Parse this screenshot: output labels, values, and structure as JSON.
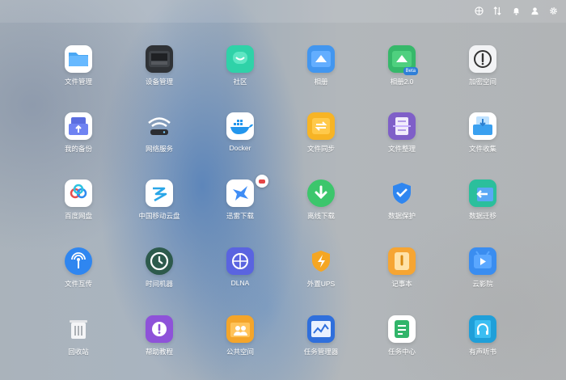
{
  "tray": {
    "icons": [
      "grid-icon",
      "sort-icon",
      "bell-icon",
      "user-icon",
      "gear-icon"
    ]
  },
  "colors": {
    "accent_blue": "#2f7fd8",
    "accent_green": "#36b86a",
    "accent_orange": "#f5a623",
    "accent_red": "#e44545"
  },
  "apps": [
    {
      "label": "文件管理",
      "icon": "folder-icon"
    },
    {
      "label": "设备管理",
      "icon": "device-icon"
    },
    {
      "label": "社区",
      "icon": "community-icon"
    },
    {
      "label": "相册",
      "icon": "photo-icon"
    },
    {
      "label": "相册2.0",
      "icon": "photo2-icon",
      "badge": "Beta"
    },
    {
      "label": "加密空间",
      "icon": "lock-icon"
    },
    {
      "label": "我的备份",
      "icon": "backup-icon"
    },
    {
      "label": "网络服务",
      "icon": "wifi-icon"
    },
    {
      "label": "Docker",
      "icon": "docker-icon"
    },
    {
      "label": "文件同步",
      "icon": "sync-icon"
    },
    {
      "label": "文件整理",
      "icon": "organize-icon"
    },
    {
      "label": "文件收集",
      "icon": "collect-icon"
    },
    {
      "label": "百度网盘",
      "icon": "baidu-icon"
    },
    {
      "label": "中国移动云盘",
      "icon": "mobile-cloud-icon"
    },
    {
      "label": "迅雷下载",
      "icon": "thunder-icon"
    },
    {
      "label": "离线下载",
      "icon": "download-icon"
    },
    {
      "label": "数据保护",
      "icon": "shield-icon"
    },
    {
      "label": "数据迁移",
      "icon": "migrate-icon"
    },
    {
      "label": "文件互传",
      "icon": "transfer-icon"
    },
    {
      "label": "时间机器",
      "icon": "time-machine-icon"
    },
    {
      "label": "DLNA",
      "icon": "dlna-icon"
    },
    {
      "label": "外置UPS",
      "icon": "ups-icon"
    },
    {
      "label": "记事本",
      "icon": "notepad-icon"
    },
    {
      "label": "云影院",
      "icon": "cinema-icon"
    },
    {
      "label": "回收站",
      "icon": "trash-icon"
    },
    {
      "label": "帮助教程",
      "icon": "help-icon"
    },
    {
      "label": "公共空间",
      "icon": "public-space-icon"
    },
    {
      "label": "任务管理器",
      "icon": "task-manager-icon"
    },
    {
      "label": "任务中心",
      "icon": "task-center-icon"
    },
    {
      "label": "有声听书",
      "icon": "audiobook-icon"
    }
  ]
}
